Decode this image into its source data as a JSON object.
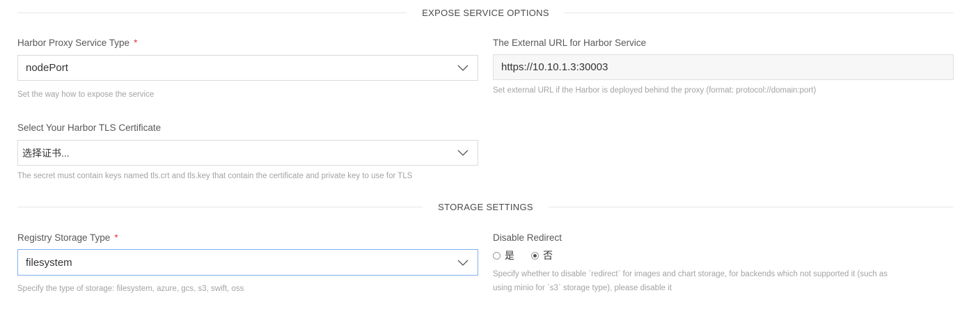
{
  "expose": {
    "section_title": "EXPOSE SERVICE OPTIONS",
    "proxy_type": {
      "label": "Harbor Proxy Service Type",
      "required_mark": "*",
      "value": "nodePort",
      "help": "Set the way how to expose the service"
    },
    "external_url": {
      "label": "The External URL for Harbor Service",
      "value": "https://10.10.1.3:30003",
      "help": "Set external URL if the Harbor is deployed behind the proxy (format: protocol://domain:port)"
    },
    "tls_cert": {
      "label": "Select Your Harbor TLS Certificate",
      "placeholder": "选择证书...",
      "help": "The secret must contain keys named tls.crt and tls.key that contain the certificate and private key to use for TLS"
    }
  },
  "storage": {
    "section_title": "STORAGE SETTINGS",
    "storage_type": {
      "label": "Registry Storage Type",
      "required_mark": "*",
      "value": "filesystem",
      "help": "Specify the type of storage: filesystem, azure, gcs, s3, swift, oss"
    },
    "disable_redirect": {
      "label": "Disable Redirect",
      "options": [
        "是",
        "否"
      ],
      "selected": "否",
      "help_line1": "Specify whether to disable `redirect` for images and chart storage, for backends which not supported it (such as",
      "help_line2": "using minio for `s3` storage type), please disable it"
    }
  }
}
